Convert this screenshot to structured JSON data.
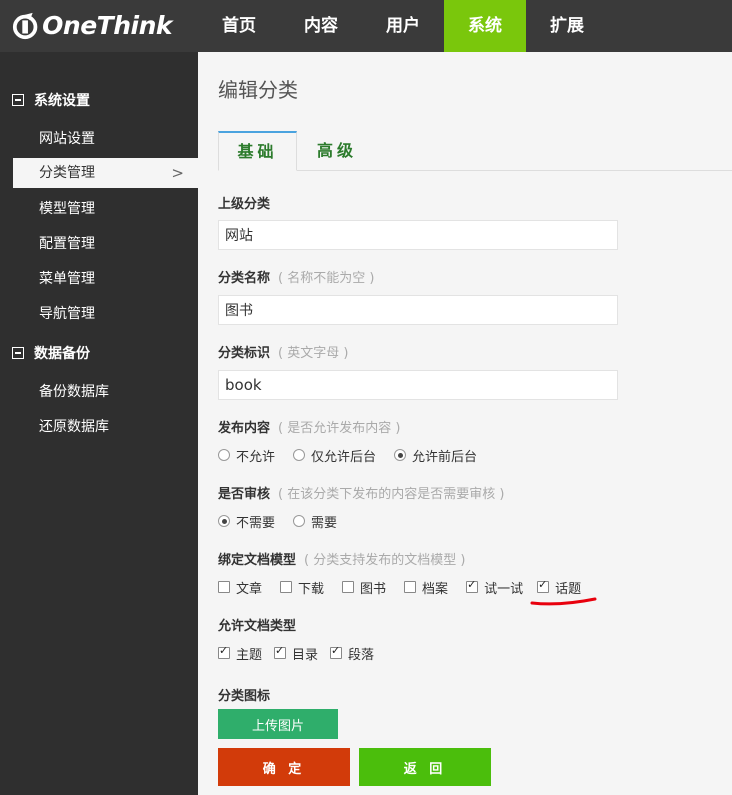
{
  "brand": {
    "logo_text": "OneThink"
  },
  "nav": {
    "items": [
      {
        "label": "首页"
      },
      {
        "label": "内容"
      },
      {
        "label": "用户"
      },
      {
        "label": "系统"
      },
      {
        "label": "扩展"
      }
    ],
    "active": "系统"
  },
  "sidebar": {
    "groups": [
      {
        "title": "系统设置",
        "items": [
          "网站设置",
          "分类管理",
          "模型管理",
          "配置管理",
          "菜单管理",
          "导航管理"
        ]
      },
      {
        "title": "数据备份",
        "items": [
          "备份数据库",
          "还原数据库"
        ]
      }
    ],
    "active_item": "分类管理",
    "active_chevron": ">"
  },
  "page": {
    "title": "编辑分类",
    "tabs": [
      {
        "label": "基础"
      },
      {
        "label": "高级"
      }
    ],
    "active_tab": "基础"
  },
  "form": {
    "parent": {
      "label": "上级分类",
      "value": "网站"
    },
    "name": {
      "label": "分类名称",
      "hint": "( 名称不能为空 )",
      "value": "图书"
    },
    "identifier": {
      "label": "分类标识",
      "hint": "( 英文字母 )",
      "value": "book"
    },
    "publish": {
      "label": "发布内容",
      "hint": "( 是否允许发布内容 )",
      "options": [
        {
          "label": "不允许",
          "checked": false
        },
        {
          "label": "仅允许后台",
          "checked": false
        },
        {
          "label": "允许前后台",
          "checked": true
        }
      ]
    },
    "audit": {
      "label": "是否审核",
      "hint": "( 在该分类下发布的内容是否需要审核 )",
      "options": [
        {
          "label": "不需要",
          "checked": true
        },
        {
          "label": "需要",
          "checked": false
        }
      ]
    },
    "models": {
      "label": "绑定文档模型",
      "hint": "( 分类支持发布的文档模型 )",
      "options": [
        {
          "label": "文章",
          "checked": false
        },
        {
          "label": "下载",
          "checked": false
        },
        {
          "label": "图书",
          "checked": false
        },
        {
          "label": "档案",
          "checked": false
        },
        {
          "label": "试一试",
          "checked": true
        },
        {
          "label": "话题",
          "checked": true
        }
      ]
    },
    "doc_types": {
      "label": "允许文档类型",
      "options": [
        {
          "label": "主题",
          "checked": true
        },
        {
          "label": "目录",
          "checked": true
        },
        {
          "label": "段落",
          "checked": true
        }
      ]
    },
    "icon": {
      "label": "分类图标",
      "upload_label": "上传图片"
    }
  },
  "actions": {
    "ok_label": "确 定",
    "back_label": "返 回"
  },
  "colors": {
    "topbar": "#3a3a3a",
    "nav_active": "#7ac70c",
    "sidebar": "#2f2f2f",
    "upload": "#2fae6b",
    "ok": "#d23b0a",
    "back": "#4bbe0c",
    "annotation": "#e8000d"
  }
}
